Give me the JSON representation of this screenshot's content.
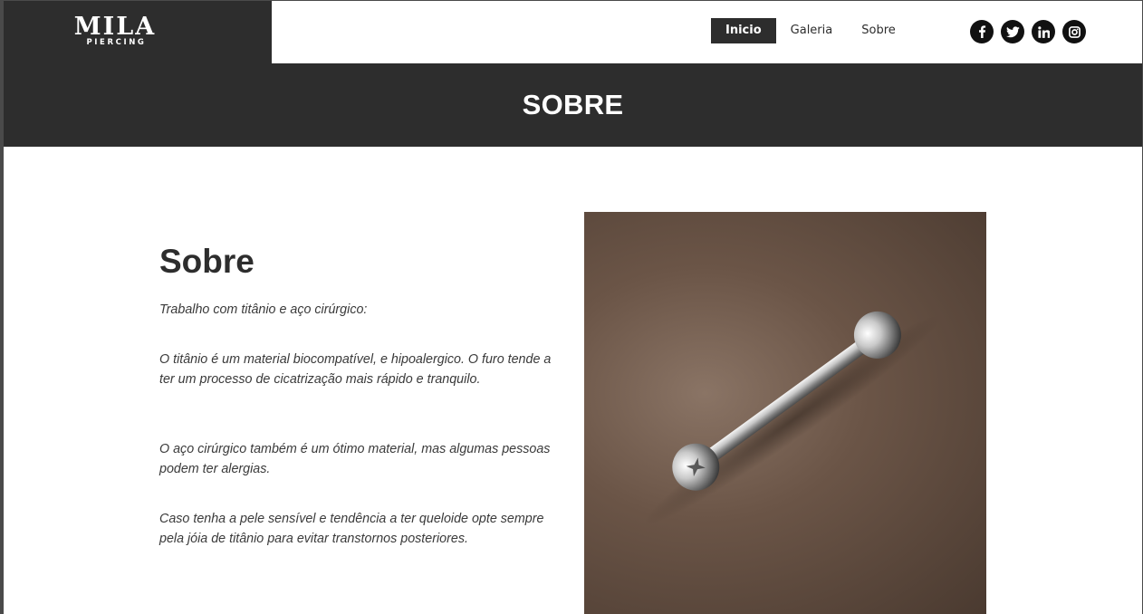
{
  "brand": {
    "name": "MILA",
    "tagline": "PIERCING"
  },
  "nav": {
    "items": [
      {
        "label": "Inicio",
        "active": true
      },
      {
        "label": "Galeria",
        "active": false
      },
      {
        "label": "Sobre",
        "active": false
      }
    ]
  },
  "social": [
    {
      "icon": "facebook-icon"
    },
    {
      "icon": "twitter-icon"
    },
    {
      "icon": "linkedin-icon"
    },
    {
      "icon": "instagram-icon"
    }
  ],
  "banner": {
    "title": "SOBRE"
  },
  "about": {
    "heading": "Sobre",
    "paragraphs": [
      "Trabalho com titânio e aço cirúrgico:",
      "O titânio é um material biocompatível, e hipoalergico. O furo tende a ter um processo de cicatrização mais rápido e tranquilo.",
      "O aço cirúrgico também é um ótimo material, mas algumas pessoas podem ter alergias.",
      "Caso tenha a pele sensível e tendência a ter queloide opte sempre pela jóia de titânio para evitar transtornos posteriores."
    ]
  },
  "image": {
    "subject": "barbell-piercing-photo"
  },
  "colors": {
    "dark": "#2d2d2d",
    "white": "#ffffff",
    "photo_bg": "#6b5547"
  }
}
